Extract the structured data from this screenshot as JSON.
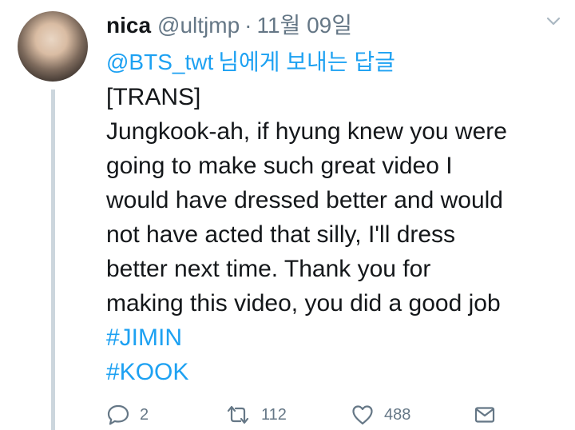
{
  "tweet": {
    "author_name": "nica",
    "author_handle": "@ultjmp",
    "separator": "·",
    "date": "11월 09일",
    "reply_to": {
      "mention": "@BTS_twt",
      "suffix": "님에게 보내는 답글"
    },
    "body_lines": [
      "[TRANS]",
      "Jungkook-ah, if hyung knew you were",
      "going to make such great video I",
      "would have dressed better and would",
      "not have acted that silly, I'll dress",
      "better next time. Thank you for",
      "making this video, you did a good job"
    ],
    "hashtags": [
      "#JIMIN",
      "#KOOK"
    ],
    "stats": {
      "replies": "2",
      "retweets": "112",
      "likes": "488"
    }
  },
  "icons": {
    "avatar": "avatar",
    "menu": "chevron-down-icon",
    "reply": "reply-icon",
    "retweet": "retweet-icon",
    "like": "heart-icon",
    "dm": "envelope-icon"
  },
  "colors": {
    "link": "#1da1f2",
    "secondary": "#657786",
    "text": "#14171a",
    "thread_line": "#ccd6dd"
  }
}
